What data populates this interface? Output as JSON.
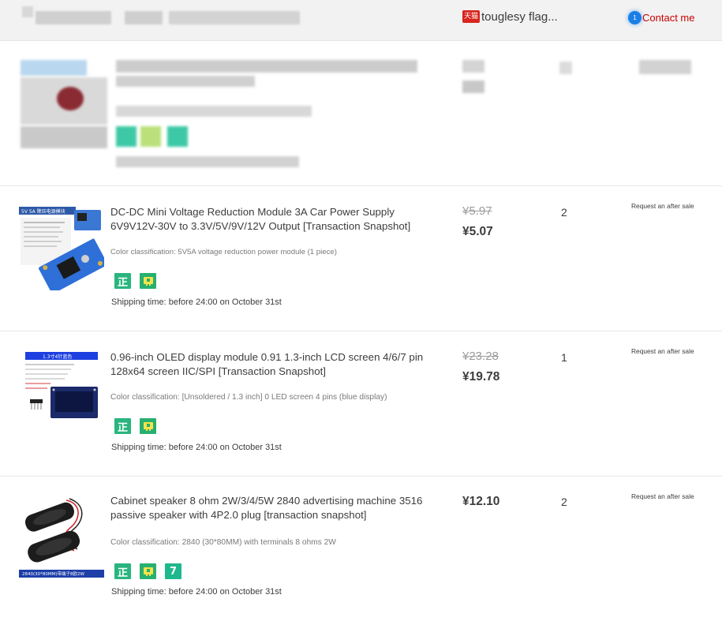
{
  "header": {
    "shop_badge": "天猫",
    "shop_name": "touglesy flag...",
    "contact_label": "Contact me",
    "contact_badge": "1"
  },
  "items": [
    {
      "title": "DC-DC Mini Voltage Reduction Module 3A Car Power Supply 6V9V12V-30V to 3.3V/5V/9V/12V Output [Transaction Snapshot]",
      "sku": "Color classification: 5V5A voltage reduction power module (1 piece)",
      "shipping": "Shipping time: before 24:00 on October 31st",
      "price_original": "¥5.97",
      "price_paid": "¥5.07",
      "quantity": "2",
      "after_sale": "Request an after sale",
      "thumb_label": "5V 5A 降压电源模块"
    },
    {
      "title": "0.96-inch OLED display module 0.91 1.3-inch LCD screen 4/6/7 pin 128x64 screen IIC/SPI [Transaction Snapshot]",
      "sku": "Color classification: [Unsoldered / 1.3 inch] 0 LED screen 4 pins (blue display)",
      "shipping": "Shipping time: before 24:00 on October 31st",
      "price_original": "¥23.28",
      "price_paid": "¥19.78",
      "quantity": "1",
      "after_sale": "Request an after sale",
      "thumb_label": "1.3寸4针蓝色"
    },
    {
      "title": "Cabinet speaker 8 ohm 2W/3/4/5W 2840 advertising machine 3516 passive speaker with 4P2.0 plug [transaction snapshot]",
      "sku": "Color classification: 2840 (30*80MM) with terminals 8 ohms 2W",
      "shipping": "Shipping time: before 24:00 on October 31st",
      "price_paid": "¥12.10",
      "quantity": "2",
      "after_sale": "Request an after sale",
      "thumb_label": "2840(30*80MM)带端子8欧2W"
    }
  ],
  "service_icons": [
    "genuine-icon",
    "guarantee-icon",
    "seven-day-return-icon"
  ],
  "service_glyphs": {
    "genuine": "正",
    "seven_day": "7"
  },
  "colors": {
    "accent_red": "#c80000",
    "service_green": "#29b57e",
    "header_bg": "#f2f2f2"
  }
}
